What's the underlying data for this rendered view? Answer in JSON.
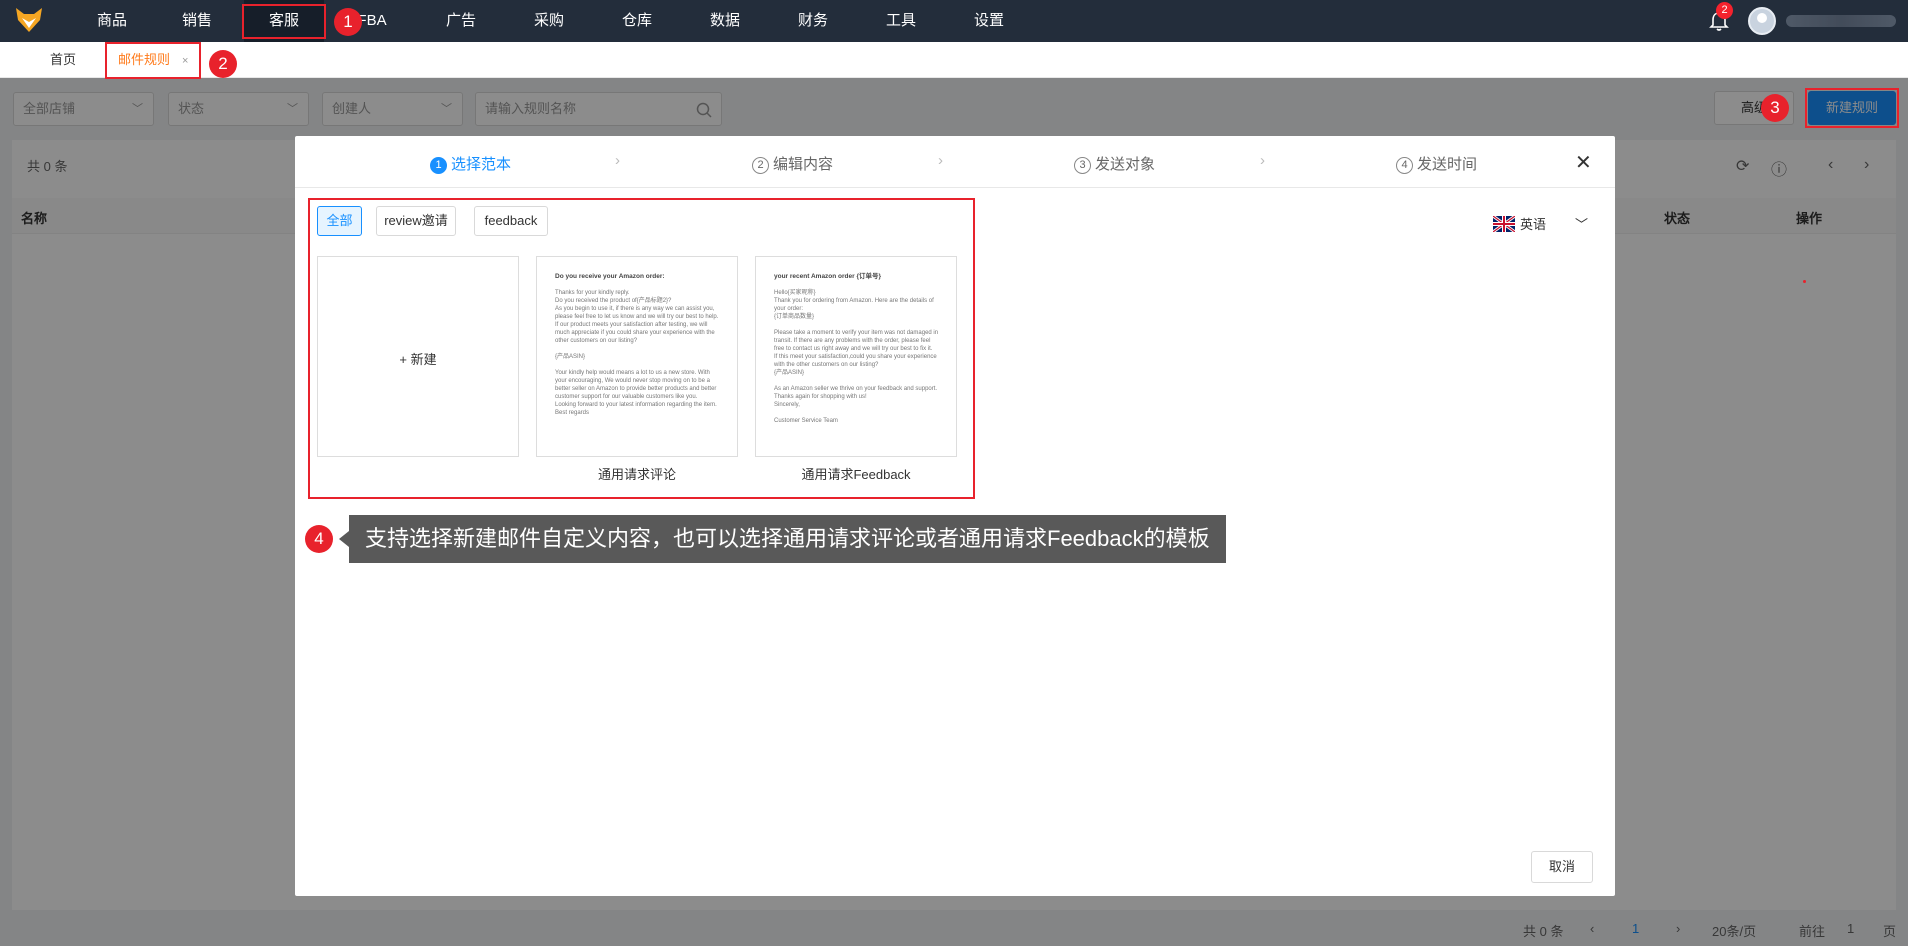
{
  "nav": {
    "items": [
      "商品",
      "销售",
      "客服",
      "FBA",
      "广告",
      "采购",
      "仓库",
      "数据",
      "财务",
      "工具",
      "设置"
    ],
    "active": "客服",
    "notification_count": "2"
  },
  "tabs": {
    "home": "首页",
    "current": "邮件规则",
    "close": "×"
  },
  "filters": {
    "store": "全部店铺",
    "status": "状态",
    "creator": "创建人",
    "search_placeholder": "请输入规则名称"
  },
  "actions": {
    "advanced": "高级",
    "new_rule": "新建规则"
  },
  "table": {
    "total": "共 0 条",
    "col_name": "名称",
    "col_status": "状态",
    "col_action": "操作"
  },
  "pagination": {
    "total": "共 0 条",
    "current_page": "1",
    "page_size": "20条/页",
    "goto_label": "前往",
    "goto_value": "1",
    "page_unit": "页"
  },
  "modal": {
    "steps": [
      {
        "num": "1",
        "label": "选择范本"
      },
      {
        "num": "2",
        "label": "编辑内容"
      },
      {
        "num": "3",
        "label": "发送对象"
      },
      {
        "num": "4",
        "label": "发送时间"
      }
    ],
    "active_step": 1,
    "filter_buttons": [
      "全部",
      "review邀请",
      "feedback"
    ],
    "active_filter": "全部",
    "language": "英语",
    "new_card_label": "+ 新建",
    "templates": [
      {
        "caption": "通用请求评论",
        "title": "Do you receive your Amazon order:",
        "body": "Thanks for your kindly reply.\nDo you received the product of{产品标题2}?\nAs you begin to use it, if there is any way we can assist you, please feel free to let us know and we will try our best to help.\nIf our product meets your satisfaction after testing, we will much appreciate if you could share your experience with the other customers on our listing?\n\n{产品ASIN}\n\nYour kindly help would means a lot to us a new store. With your encouraging, We would never stop moving on to be a better seller on Amazon to provide better products and better customer support for our valuable customers like you.\nLooking forward to your latest information regarding the item.\nBest regards"
      },
      {
        "caption": "通用请求Feedback",
        "title": "your recent Amazon order {订单号}",
        "body": "Hello{买家昵称}\nThank you for ordering from Amazon. Here are the details of your order:\n{订单商品数量}\n\nPlease take a moment to verify your item was not damaged in transit. If there are any problems with the order, please feel free to contact us right away and we will try our best to fix it.\nIf this meet your satisfaction,could you share your experience with the other customers on our listing?\n{产品ASIN}\n\nAs an Amazon seller we thrive on your feedback and support. Thanks again for shopping with us!\nSincerely,\n\nCustomer Service Team"
      }
    ],
    "cancel": "取消"
  },
  "annotations": {
    "badges": [
      "1",
      "2",
      "3",
      "4"
    ],
    "tooltip": "支持选择新建邮件自定义内容，也可以选择通用请求评论或者通用请求Feedback的模板"
  },
  "colors": {
    "nav_bg": "#232d3b",
    "primary": "#1890ff",
    "active_tab": "#ff7a1a",
    "annotation_red": "#e8222c"
  }
}
